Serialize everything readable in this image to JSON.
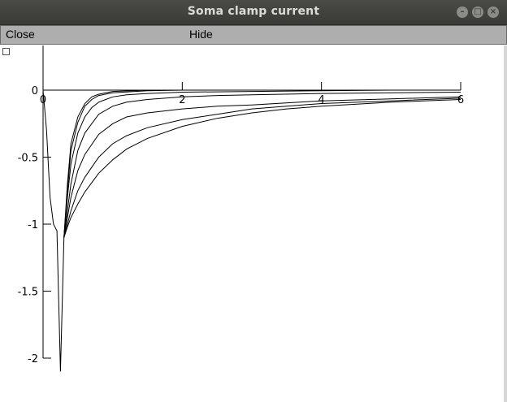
{
  "window": {
    "title": "Soma clamp current"
  },
  "titlebar_icons": [
    "minimize-icon",
    "maximize-icon",
    "close-icon"
  ],
  "menu": {
    "close_label": "Close",
    "hide_label": "Hide"
  },
  "chart_data": {
    "type": "line",
    "title": "",
    "xlabel": "",
    "ylabel": "",
    "xlim": [
      0,
      6
    ],
    "ylim": [
      -2.1,
      0.35
    ],
    "x_ticks": [
      {
        "value": 0,
        "label": "0"
      },
      {
        "value": 2,
        "label": "2"
      },
      {
        "value": 4,
        "label": "4"
      },
      {
        "value": 6,
        "label": "6"
      }
    ],
    "y_ticks": [
      {
        "value": 0,
        "label": "0"
      },
      {
        "value": -0.5,
        "label": "-0.5"
      },
      {
        "value": -1,
        "label": "-1"
      },
      {
        "value": -1.5,
        "label": "-1.5"
      },
      {
        "value": -2,
        "label": "-2"
      }
    ],
    "series": [
      {
        "x": [
          0,
          0.05,
          0.1,
          0.15,
          0.2,
          0.25,
          0.28,
          0.3,
          0.35,
          0.4,
          0.5,
          0.6,
          0.7,
          0.8,
          1.0,
          1.5,
          2,
          3,
          4,
          5,
          6
        ],
        "y": [
          0,
          -0.3,
          -0.8,
          -1.0,
          -1.05,
          -2.1,
          -1.5,
          -1.1,
          -0.7,
          -0.4,
          -0.2,
          -0.1,
          -0.05,
          -0.03,
          -0.01,
          0,
          0,
          0,
          0,
          0,
          0
        ]
      },
      {
        "x": [
          0.3,
          0.35,
          0.4,
          0.5,
          0.6,
          0.7,
          0.8,
          1.0,
          1.5,
          2,
          3,
          4,
          5,
          6
        ],
        "y": [
          -1.1,
          -0.75,
          -0.45,
          -0.24,
          -0.12,
          -0.07,
          -0.04,
          -0.02,
          -0.005,
          0,
          0,
          0,
          0,
          0
        ]
      },
      {
        "x": [
          0.3,
          0.35,
          0.4,
          0.5,
          0.6,
          0.7,
          0.8,
          1.0,
          1.2,
          1.5,
          2,
          3,
          4,
          5,
          6
        ],
        "y": [
          -1.1,
          -0.8,
          -0.55,
          -0.32,
          -0.2,
          -0.13,
          -0.09,
          -0.05,
          -0.035,
          -0.025,
          -0.015,
          -0.01,
          -0.005,
          0,
          0
        ]
      },
      {
        "x": [
          0.3,
          0.35,
          0.4,
          0.5,
          0.6,
          0.8,
          1.0,
          1.2,
          1.5,
          2,
          2.5,
          3,
          4,
          5,
          6
        ],
        "y": [
          -1.1,
          -0.9,
          -0.7,
          -0.45,
          -0.32,
          -0.18,
          -0.12,
          -0.09,
          -0.07,
          -0.05,
          -0.04,
          -0.035,
          -0.025,
          -0.02,
          -0.015
        ]
      },
      {
        "x": [
          0.3,
          0.35,
          0.4,
          0.5,
          0.6,
          0.8,
          1.0,
          1.2,
          1.5,
          2,
          2.5,
          3,
          4,
          5,
          6
        ],
        "y": [
          -1.1,
          -0.95,
          -0.8,
          -0.6,
          -0.48,
          -0.33,
          -0.25,
          -0.2,
          -0.17,
          -0.14,
          -0.12,
          -0.11,
          -0.08,
          -0.065,
          -0.05
        ]
      },
      {
        "x": [
          0.3,
          0.4,
          0.5,
          0.6,
          0.8,
          1.0,
          1.2,
          1.5,
          2,
          2.5,
          3,
          3.5,
          4,
          5,
          6
        ],
        "y": [
          -1.1,
          -0.9,
          -0.75,
          -0.65,
          -0.5,
          -0.4,
          -0.34,
          -0.28,
          -0.22,
          -0.18,
          -0.14,
          -0.12,
          -0.1,
          -0.08,
          -0.06
        ]
      },
      {
        "x": [
          0.3,
          0.35,
          0.4,
          0.5,
          0.6,
          0.8,
          1.0,
          1.2,
          1.5,
          2,
          2.5,
          3,
          3.5,
          4,
          5,
          6
        ],
        "y": [
          -1.1,
          -1.02,
          -0.95,
          -0.85,
          -0.76,
          -0.62,
          -0.52,
          -0.44,
          -0.36,
          -0.27,
          -0.21,
          -0.17,
          -0.14,
          -0.12,
          -0.09,
          -0.07
        ]
      }
    ]
  }
}
